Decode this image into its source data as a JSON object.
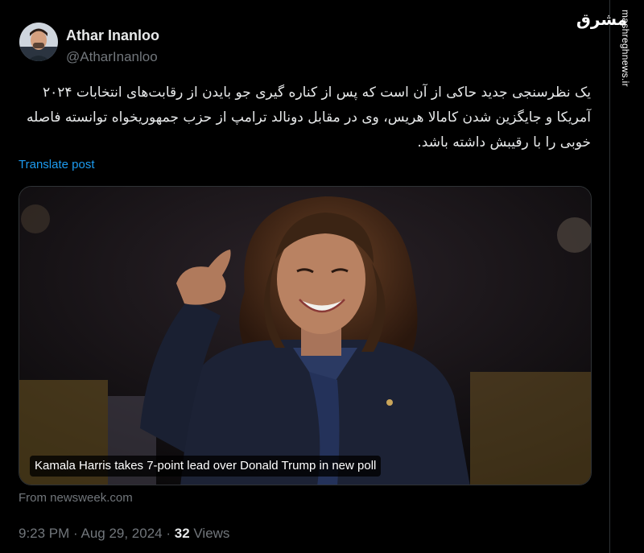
{
  "author": {
    "display_name": "Athar Inanloo",
    "handle": "@AtharInanloo"
  },
  "watermark": {
    "logo": "مشرق",
    "url": "mashreghnews.ir"
  },
  "tweet": {
    "text": "یک نظرسنجی جدید حاکی از آن است که پس از کناره گیری جو بایدن از رقابت‌های انتخابات ۲۰۲۴ آمریکا و جایگزین شدن کامالا هریس، وی در مقابل دونالد ترامپ از حزب جمهوریخواه توانسته فاصله خوبی را با رقیبش داشته باشد.",
    "translate_label": "Translate post"
  },
  "card": {
    "caption": "Kamala Harris takes 7-point lead over Donald Trump in new poll",
    "source": "From newsweek.com"
  },
  "meta": {
    "time": "9:23 PM · Aug 29, 2024",
    "separator": " · ",
    "views_count": "32",
    "views_label": " Views"
  },
  "colors": {
    "background": "#000000",
    "text": "#e7e9ea",
    "secondary": "#71767b",
    "link": "#1d9bf0",
    "border": "#2f3336"
  }
}
